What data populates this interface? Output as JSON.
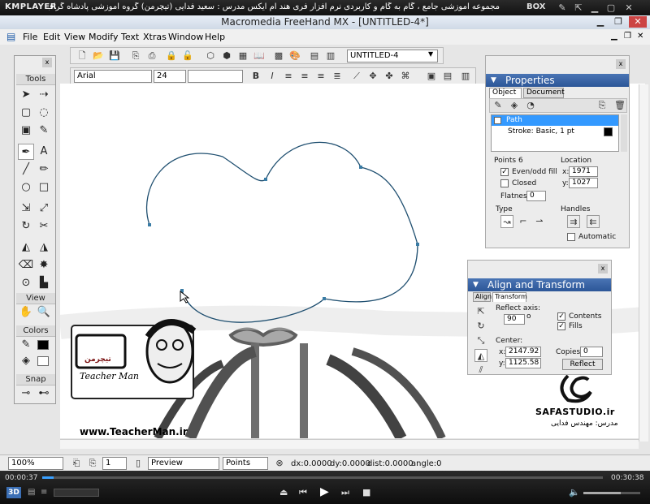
{
  "kmplayer": {
    "logo": "KMPLAYER",
    "title": "مجموعه آموزشی جامع ، گام به گام و کاربردی نرم افزار فری هند ام ایکس   مدرس : سعید فدایی (تیچرمن) گروه آموزشی پادشاه گرافیست ها",
    "box_label": "BOX"
  },
  "freehand": {
    "title": "Macromedia FreeHand MX - [UNTITLED-4*]",
    "menu": [
      "File",
      "Edit",
      "View",
      "Modify",
      "Text",
      "Xtras",
      "Window",
      "Help"
    ],
    "document_select": "UNTITLED-4",
    "font_name": "Arial",
    "font_size": "24"
  },
  "tools": {
    "title": "Tools",
    "view_label": "View",
    "colors_label": "Colors",
    "snap_label": "Snap"
  },
  "properties": {
    "title": "Properties",
    "tab_object": "Object",
    "tab_document": "Document",
    "item_path": "Path",
    "item_stroke": "Stroke: Basic, 1 pt",
    "points_label": "Points",
    "points_value": "6",
    "evenodd_label": "Even/odd fill",
    "closed_label": "Closed",
    "flatness_label": "Flatness:",
    "flatness_value": "0",
    "location_label": "Location",
    "x_label": "x:",
    "x_value": "1971",
    "y_label": "y:",
    "y_value": "1027",
    "type_label": "Type",
    "handles_label": "Handles",
    "automatic_label": "Automatic"
  },
  "align": {
    "title": "Align and Transform",
    "tab_align": "Align",
    "tab_transform": "Transform",
    "reflect_label": "Reflect axis:",
    "reflect_value": "90",
    "contents_label": "Contents",
    "fills_label": "Fills",
    "center_label": "Center:",
    "cx_label": "x:",
    "cx_value": "2147.92",
    "cy_label": "y:",
    "cy_value": "1125.58",
    "copies_label": "Copies:",
    "copies_value": "0",
    "reflect_button": "Reflect"
  },
  "watermark": {
    "logo_text": "تیچرمن",
    "teacher_man": "Teacher Man",
    "site": "www.TeacherMan.ir",
    "safa": "SAFASTUDIO.ir",
    "instructor": "مدرس: مهندس فدایی"
  },
  "status": {
    "zoom": "100%",
    "page": "1",
    "view_mode": "Preview",
    "units": "Points",
    "dx": "dx:0.0000",
    "dy": "dy:0.0000",
    "dist": "dist:0.0000",
    "angle": "angle:0"
  },
  "player": {
    "time_current": "00:00:37",
    "time_total": "00:30:38",
    "progress_fraction": 0.02,
    "badge_3d": "3D",
    "volume_fraction": 0.65
  },
  "colors": {
    "selection_blue": "#3399ff",
    "panel_header": "#2c5697",
    "path_stroke": "#1f4f70"
  }
}
